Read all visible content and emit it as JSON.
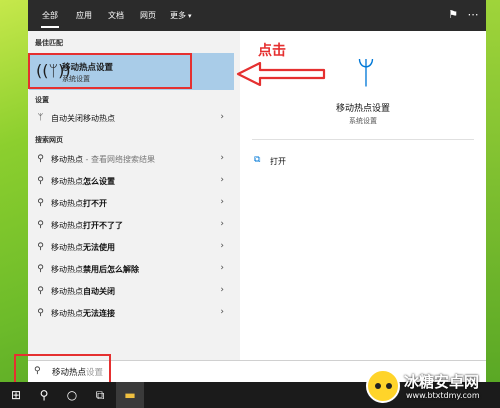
{
  "tabs": [
    {
      "label": "全部",
      "active": true
    },
    {
      "label": "应用",
      "active": false
    },
    {
      "label": "文档",
      "active": false
    },
    {
      "label": "网页",
      "active": false
    },
    {
      "label": "更多",
      "active": false
    }
  ],
  "topbar_icons": [
    "feedback-icon",
    "more-options-icon"
  ],
  "sections": {
    "best_match": "最佳匹配",
    "settings": "设置",
    "web": "搜索网页"
  },
  "best_match": {
    "title": "移动热点设置",
    "subtitle": "系统设置",
    "icon": "wifi-hotspot-icon"
  },
  "settings_items": [
    {
      "label": "自动关闭移动热点",
      "icon": "wifi-hotspot-icon"
    }
  ],
  "web_items": [
    {
      "query": "移动热点",
      "suffix": " - 查看网络搜索结果"
    },
    {
      "query": "移动热点",
      "suffix": "怎么设置"
    },
    {
      "query": "移动热点",
      "suffix": "打不开"
    },
    {
      "query": "移动热点",
      "suffix": "打开不了了"
    },
    {
      "query": "移动热点",
      "suffix": "无法使用"
    },
    {
      "query": "移动热点",
      "suffix": "禁用后怎么解除"
    },
    {
      "query": "移动热点",
      "suffix": "自动关闭"
    },
    {
      "query": "移动热点",
      "suffix": "无法连接"
    }
  ],
  "right_pane": {
    "title": "移动热点设置",
    "subtitle": "系统设置",
    "open_label": "打开"
  },
  "annotation": {
    "label": "点击",
    "color": "#e53030"
  },
  "search": {
    "typed": "移动热点",
    "ghost": "设置"
  },
  "taskbar_items": [
    "windows-start-icon",
    "search-icon",
    "cortana-circle-icon",
    "task-view-icon",
    "file-explorer-icon"
  ],
  "watermark": {
    "name": "冰糖安卓网",
    "url": "www.btxtdmy.com"
  },
  "colors": {
    "accent": "#0078d7",
    "selection": "#a9cce8",
    "topbar": "#2b2b2b",
    "taskbar": "#1b1b1b"
  }
}
